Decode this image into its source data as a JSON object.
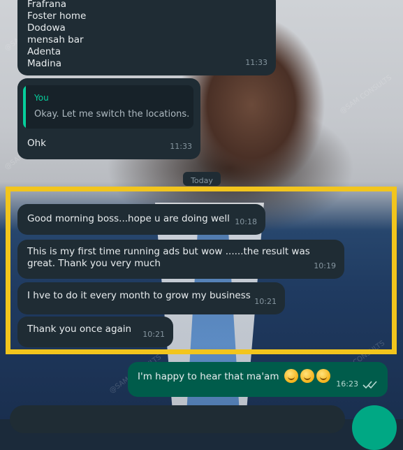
{
  "colors": {
    "incoming_bubble": "#1f2c34",
    "outgoing_bubble": "#005c4b",
    "highlight_border": "#f2c51d",
    "accent": "#06cf9c"
  },
  "list_message": {
    "lines": [
      "Frafrana",
      "Foster home",
      "Dodowa",
      "mensah bar",
      "Adenta",
      "Madina"
    ],
    "time": "11:33"
  },
  "reply_message": {
    "quoted_author": "You",
    "quoted_text": "Okay. Let me switch the locations.",
    "text": "Ohk",
    "time": "11:33"
  },
  "date_separator": "Today",
  "highlighted_messages": [
    {
      "text": "Good morning boss...hope u are doing well",
      "time": "10:18"
    },
    {
      "text": "This is my first time running ads but wow ......the result was great. Thank you very much",
      "time": "10:19"
    },
    {
      "text": "I hve to do it every month to grow my business",
      "time": "10:21"
    },
    {
      "text": "Thank you once again",
      "time": "10:21"
    }
  ],
  "outgoing_message": {
    "text": "I'm happy to hear that ma'am",
    "emoji_count": 3,
    "time": "16:23",
    "status_icon": "double-check-icon"
  },
  "watermark": "@SAM CONSULTS"
}
